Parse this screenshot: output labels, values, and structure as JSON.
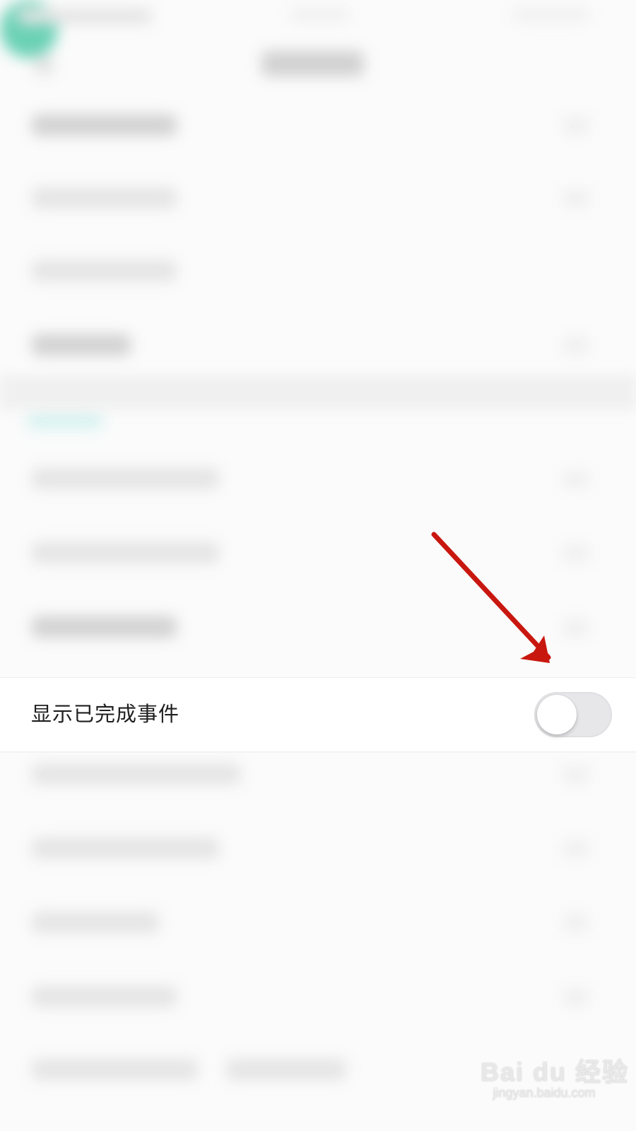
{
  "settings": {
    "show_completed_label": "显示已完成事件",
    "show_completed_toggle_state": "off"
  },
  "watermark": {
    "logo_text": "Bai du 经验",
    "url": "jingyan.baidu.com"
  },
  "colors": {
    "annotation_arrow": "#c8170f",
    "accent_teal": "#63cfb2",
    "toggle_off": "#e7e7ea"
  }
}
